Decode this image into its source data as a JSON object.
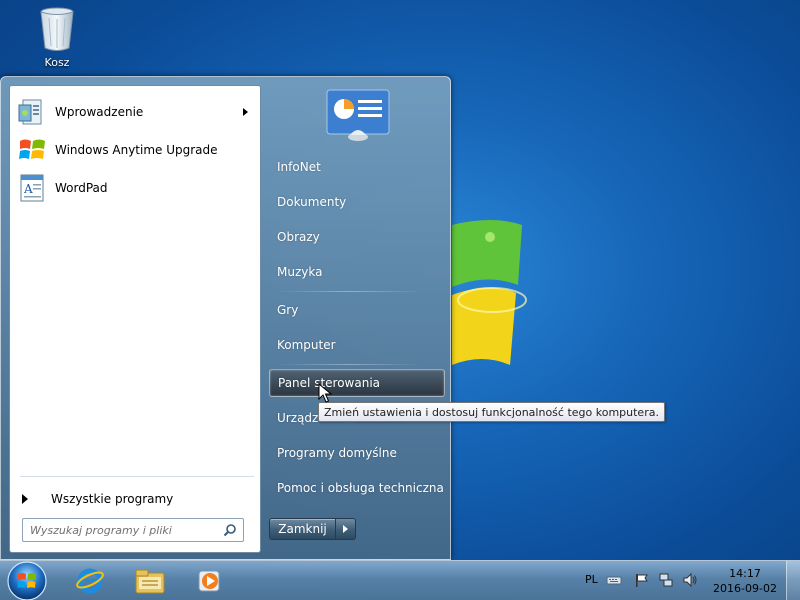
{
  "desktop": {
    "recycle_bin_label": "Kosz"
  },
  "start_menu": {
    "programs": [
      {
        "label": "Wprowadzenie",
        "icon": "getting-started-icon",
        "has_submenu": true
      },
      {
        "label": "Windows Anytime Upgrade",
        "icon": "windows-flag-icon",
        "has_submenu": false
      },
      {
        "label": "WordPad",
        "icon": "wordpad-icon",
        "has_submenu": false
      }
    ],
    "all_programs": "Wszystkie programy",
    "search_placeholder": "Wyszukaj programy i pliki",
    "right_items": [
      {
        "label": "InfoNet"
      },
      {
        "label": "Dokumenty"
      },
      {
        "label": "Obrazy"
      },
      {
        "label": "Muzyka"
      },
      {
        "label": "Gry"
      },
      {
        "label": "Komputer"
      },
      {
        "label": "Panel sterowania",
        "active": true
      },
      {
        "label": "Urządzenia i drukarki"
      },
      {
        "label": "Programy domyślne"
      },
      {
        "label": "Pomoc i obsługa techniczna"
      }
    ],
    "shutdown_label": "Zamknij",
    "tooltip": "Zmień ustawienia i dostosuj funkcjonalność tego komputera."
  },
  "taskbar": {
    "language": "PL",
    "time": "14:17",
    "date": "2016-09-02",
    "pinned": [
      "internet-explorer-icon",
      "file-explorer-icon",
      "media-player-icon"
    ]
  },
  "colors": {
    "desktop_blue": "#1665b7",
    "tooltip_bg": "#ffffff",
    "menu_glass": "#5a7f9c"
  }
}
